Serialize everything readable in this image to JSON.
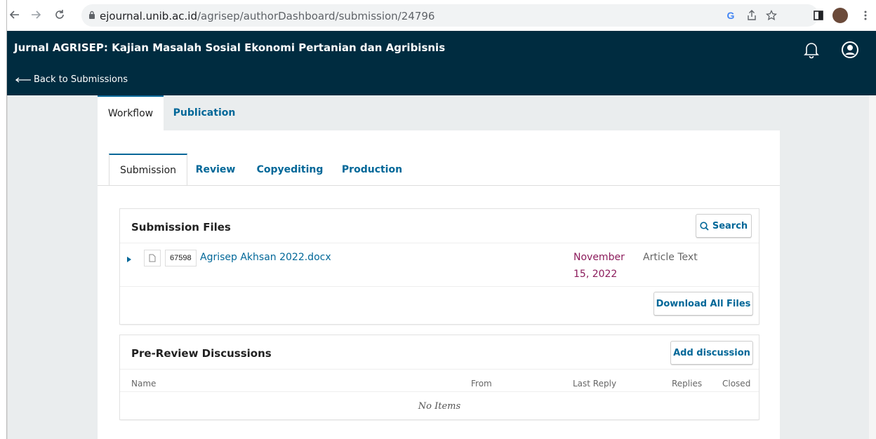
{
  "browser": {
    "url_domain": "ejournal.unib.ac.id",
    "url_path": "/agrisep/authorDashboard/submission/24796"
  },
  "header": {
    "journal_title": "Jurnal AGRISEP: Kajian Masalah Sosial Ekonomi Pertanian dan Agribisnis",
    "back_label": "Back to Submissions"
  },
  "top_tabs": [
    {
      "label": "Workflow",
      "active": true
    },
    {
      "label": "Publication",
      "active": false
    }
  ],
  "sub_tabs": [
    {
      "label": "Submission",
      "active": true
    },
    {
      "label": "Review",
      "active": false
    },
    {
      "label": "Copyediting",
      "active": false
    },
    {
      "label": "Production",
      "active": false
    }
  ],
  "submission_files": {
    "title": "Submission Files",
    "search_label": "Search",
    "download_all_label": "Download All Files",
    "files": [
      {
        "id": "67598",
        "name": "Agrisep Akhsan 2022.docx",
        "date_line1": "November",
        "date_line2": "15, 2022",
        "type": "Article Text"
      }
    ]
  },
  "discussions": {
    "title": "Pre-Review Discussions",
    "add_label": "Add discussion",
    "columns": [
      "Name",
      "From",
      "Last Reply",
      "Replies",
      "Closed"
    ],
    "empty_label": "No Items"
  },
  "colors": {
    "header_bg": "#002c40",
    "link": "#006798",
    "date": "#8c1c5c"
  }
}
